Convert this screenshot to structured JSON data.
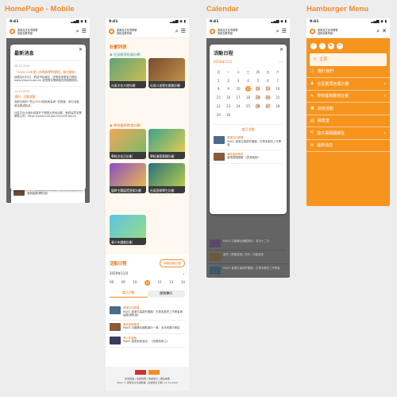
{
  "columns": [
    "HomePage - Mobile",
    "Calendar",
    "Hamburger Menu"
  ],
  "status": {
    "time": "9:41",
    "signal": "▂▄▆ ◉ ▮"
  },
  "brand": {
    "line1": "康樂及文化事務署",
    "line2": "藝術及教育部"
  },
  "home": {
    "modal_title": "最新消息",
    "news": [
      {
        "date": "28.10.2020",
        "title": "「2020-22年度八和粵劇學院課程」報名開始",
        "body": "延續至8月5日，歡迎市民報名，詳情請參閱官方網站 www.hkbarts.gov.hk 或瀏覽本署網頁查詢相關資料。"
      },
      {
        "date": "12.10.2020",
        "title": "通知：活動調整",
        "body": "為配合政府 \"防止2019冠狀病毒病\" 的措施，部分活動將延期或取消。"
      },
      {
        "date": "",
        "title": "",
        "body": "社區文化大使計劃將於下期推出其他活動，敬請留意本署網頁公布：https://www.lcsd.gov.hk/ce/Museum"
      }
    ],
    "programme_title": "計劃列表",
    "cat1": "社區觀眾拓展計劃",
    "cat2": "學校藝術教育計劃",
    "tiles": [
      "社區文化大使計劃",
      "社區口述歷史戲劇計劃",
      "學校文化日計劃",
      "學校演藝實踐計劃",
      "臨時主題展覽藝術計劃",
      "社區藝術學生計劃",
      "青少年戲劇計劃"
    ],
    "calendar_title": "活動日程",
    "calendar_btn": "參觀活動日程",
    "month": "2020年11月",
    "days": [
      "08",
      "09",
      "10",
      "11",
      "12",
      "13",
      "14"
    ],
    "tab_today": "當日活動",
    "tab_upcoming": "即將舉行",
    "events": [
      {
        "tag": "劇場文化劇團",
        "title": "PAJ02 香港五幕劇作團團：在周末都完工作業者與曲團(網紅組)"
      },
      {
        "tag": "學校藝術教育",
        "title": "PAJ03 中國舞台團體演出一場：本月時間中東區"
      },
      {
        "tag": "青少年演藝",
        "title": "PAJ03 香港藝術演出：《知識藝術之》"
      }
    ],
    "footer_links": "私隱政策 | 免責聲明 | 版權告示 | 網站地圖",
    "footer_copy": "2020 © 康樂及文化事務署 | 最後修訂日期: 11.11.2020"
  },
  "calendar": {
    "modal_title": "活動日程",
    "month": "2020年11月",
    "weekdays": [
      "日",
      "一",
      "二",
      "三",
      "四",
      "五",
      "六"
    ],
    "grid": [
      [
        "1",
        "2",
        "3",
        "4",
        "5",
        "6",
        "7"
      ],
      [
        "8",
        "9",
        "10",
        "11",
        "12",
        "13",
        "14"
      ],
      [
        "15",
        "16",
        "17",
        "18",
        "19",
        "20",
        "21"
      ],
      [
        "22",
        "23",
        "24",
        "25",
        "26",
        "27",
        "28"
      ],
      [
        "29",
        "30",
        "",
        "",
        "",
        "",
        ""
      ]
    ],
    "highlight": "11",
    "events_head": "當日活動",
    "list": [
      {
        "tag": "劇場文化劇團",
        "title": "PAJ02 香港五幕劇作團團：在周末都完工作業者"
      },
      {
        "tag": "學校藝術教育",
        "title": "香港劇場團體 《表演藝術》"
      },
      {
        "tag": "青少年演藝",
        "title": "PAJ03 中國舞台團體演出：本月十二日"
      },
      {
        "tag": "社區藝術",
        "title": "追思《青春旅程》系列 - 中國藝術"
      }
    ]
  },
  "menu": {
    "social": [
      "f",
      "t",
      "▶",
      "✉"
    ],
    "items": [
      {
        "label": "主頁",
        "icon": "⌂",
        "active": true
      },
      {
        "label": "關於我們",
        "icon": "ⓘ"
      },
      {
        "label": "社區觀眾拓展計劃",
        "icon": "♟",
        "sub": true
      },
      {
        "label": "學校藝術教育計劃",
        "icon": "✎",
        "sub": true
      },
      {
        "label": "其他活動",
        "icon": "▦"
      },
      {
        "label": "檔案室",
        "icon": "▤"
      },
      {
        "label": "康文署相關網址",
        "icon": "⇱",
        "sub": true
      },
      {
        "label": "最新消息",
        "icon": "✉"
      }
    ]
  },
  "colors": {
    "accent": "#f28c28",
    "menu_bg": "#f7941d"
  }
}
